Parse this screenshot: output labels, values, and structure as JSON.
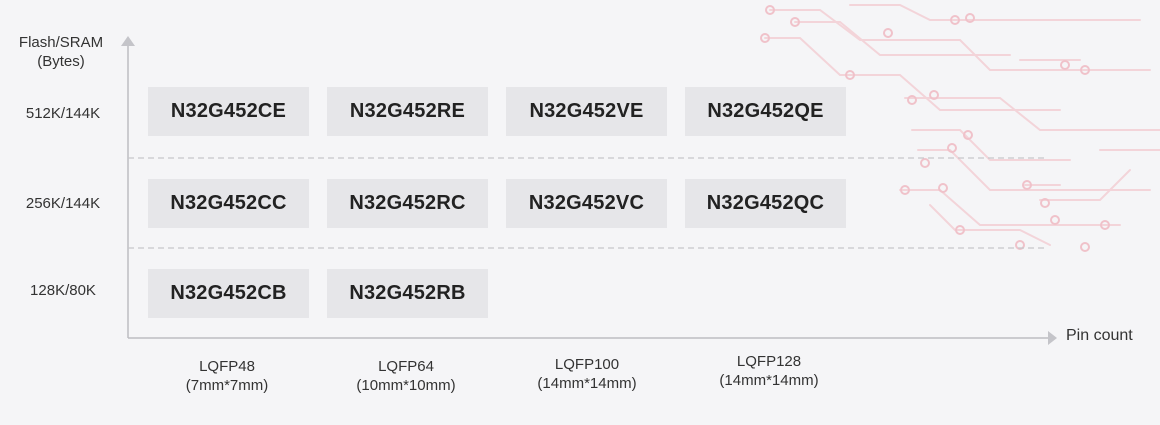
{
  "y_axis": {
    "title_line1": "Flash/SRAM",
    "title_line2": "(Bytes)",
    "levels": [
      "512K/144K",
      "256K/144K",
      "128K/80K"
    ]
  },
  "x_axis": {
    "title": "Pin count",
    "packages": [
      {
        "name": "LQFP48",
        "size": "(7mm*7mm)"
      },
      {
        "name": "LQFP64",
        "size": "(10mm*10mm)"
      },
      {
        "name": "LQFP100",
        "size": "(14mm*14mm)"
      },
      {
        "name": "LQFP128",
        "size": "(14mm*14mm)"
      }
    ]
  },
  "rows": [
    [
      "N32G452CE",
      "N32G452RE",
      "N32G452VE",
      "N32G452QE"
    ],
    [
      "N32G452CC",
      "N32G452RC",
      "N32G452VC",
      "N32G452QC"
    ],
    [
      "N32G452CB",
      "N32G452RB"
    ]
  ],
  "colors": {
    "background": "#f5f5f7",
    "chip_fill": "#e6e6e9",
    "axis": "#bdbdc2",
    "circuit_decoration": "#f2c9d0"
  }
}
